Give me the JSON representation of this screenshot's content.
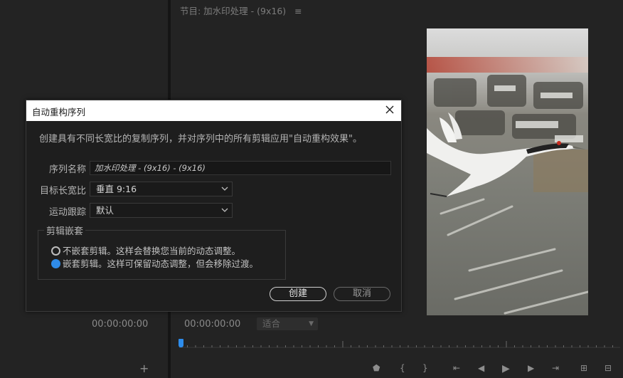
{
  "left_panel": {
    "timecode": "00:00:00:00",
    "add_label": "+"
  },
  "program_monitor": {
    "title": "节目: 加水印处理 - (9x16)",
    "menu_icon": "≡",
    "timecode": "00:00:00:00",
    "fit_select": "适合",
    "transport_buttons": [
      {
        "name": "add-marker-icon",
        "glyph": "⬟"
      },
      {
        "name": "mark-in-icon",
        "glyph": "{"
      },
      {
        "name": "mark-out-icon",
        "glyph": "}"
      },
      {
        "name": "go-to-in-icon",
        "glyph": "⇤"
      },
      {
        "name": "step-back-icon",
        "glyph": "◀"
      },
      {
        "name": "play-icon",
        "glyph": "▶"
      },
      {
        "name": "step-forward-icon",
        "glyph": "▶"
      },
      {
        "name": "go-to-out-icon",
        "glyph": "⇥"
      },
      {
        "name": "lift-icon",
        "glyph": "⊞"
      },
      {
        "name": "extract-icon",
        "glyph": "⊟"
      }
    ]
  },
  "dialog": {
    "title": "自动重构序列",
    "description": "创建具有不同长宽比的复制序列，并对序列中的所有剪辑应用\"自动重构效果\"。",
    "sequence_name_label": "序列名称",
    "sequence_name_value": "加水印处理 - (9x16) - (9x16)",
    "aspect_label": "目标长宽比",
    "aspect_value": "垂直 9:16",
    "tracking_label": "运动跟踪",
    "tracking_value": "默认",
    "clip_nesting": {
      "title": "剪辑嵌套",
      "option_no_nest": "不嵌套剪辑。这样会替换您当前的动态调整。",
      "option_nest": "嵌套剪辑。这样可保留动态调整，但会移除过渡。",
      "selected": "nest"
    },
    "create_label": "创建",
    "cancel_label": "取消"
  },
  "colors": {
    "accent": "#2f8be8",
    "panel_bg": "#232323",
    "dialog_bg": "#1e1e1e"
  }
}
